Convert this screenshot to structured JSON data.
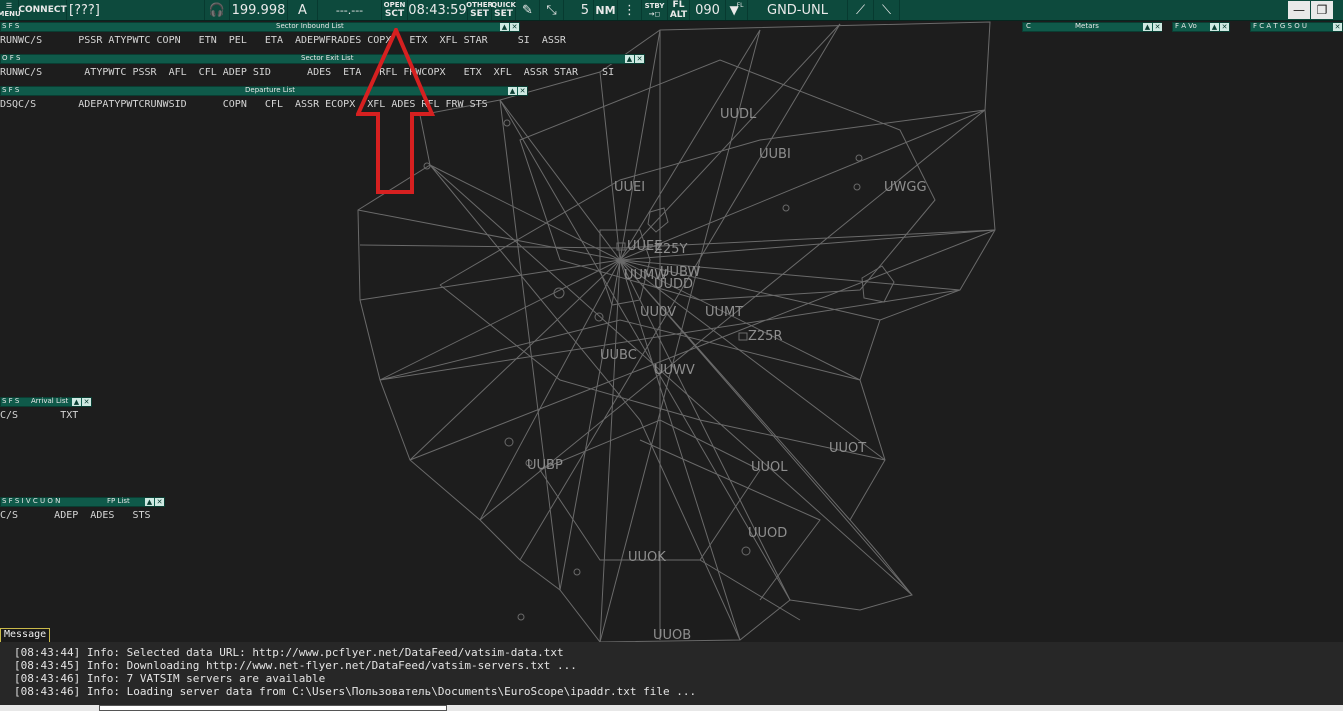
{
  "toolbar": {
    "menu_label": "MENU",
    "connect_label": "CONNECT",
    "callsign": "[???]",
    "frequency": "199.998",
    "atis_letter": "A",
    "atis_value": "---.---",
    "open_label": "OPEN",
    "sct_label": "SCT",
    "clock": "08:43:59",
    "other_label": "OTHER",
    "set_label": "SET",
    "quick_label": "QUICK",
    "set2_label": "SET",
    "range_value": "5",
    "range_unit": "NM",
    "stby_label": "STBY",
    "fl_label": "FL",
    "alt_label": "ALT",
    "fl_value": "090",
    "filter_label": "FL",
    "position": "GND-UNL"
  },
  "lists": {
    "inbound": {
      "title": "Sector Inbound List",
      "flags": "S  F  S",
      "columns": "RUNWC/S      PSSR ATYPWTC COPN   ETN  PEL   ETA  ADEPWFRADES COPX   ETX  XFL STAR     SI  ASSR"
    },
    "exit": {
      "title": "Sector Exit List",
      "flags": "O  F  S",
      "columns": "RUNWC/S       ATYPWTC PSSR  AFL  CFL ADEP SID      ADES  ETA   RFL FRWCOPX   ETX  XFL  ASSR STAR    SI"
    },
    "departure": {
      "title": "Departure List",
      "flags": "S  F  S",
      "columns": "DSQC/S       ADEPATYPWTCRUNWSID      COPN   CFL  ASSR ECOPX  XFL ADES RFL FRW STS"
    },
    "arrival": {
      "title": "Arrival List",
      "flags": "S  F  S",
      "columns": "C/S       TXT"
    },
    "fp": {
      "title": "FP List",
      "flags": "S  F  S  I  V  C  U  O  N",
      "columns": "C/S      ADEP  ADES   STS"
    },
    "metars": {
      "title": "Metars",
      "flag": "C"
    },
    "favo": {
      "title": "F  A  Vo"
    },
    "fcat": {
      "title": "F  C  A  T  G  S  O  U"
    }
  },
  "map_labels": [
    "UUDL",
    "UUBI",
    "UWGG",
    "UUEI",
    "UUEE",
    "Z25Y",
    "UUBW",
    "UUMW",
    "UUDD",
    "UUMT",
    "UU0V",
    "Z25R",
    "UUBC",
    "UUWV",
    "UUOT",
    "UUBP",
    "UUOL",
    "UUOD",
    "UUOK",
    "UUOB"
  ],
  "messages": {
    "button_label": "Message",
    "lines": [
      "[08:43:44] Info: Selected data URL: http://www.pcflyer.net/DataFeed/vatsim-data.txt",
      "[08:43:45] Info: Downloading http://www.net-flyer.net/DataFeed/vatsim-servers.txt ...",
      "[08:43:46] Info: 7 VATSIM servers are available",
      "[08:43:46] Info: Loading server data from C:\\Users\\Пользователь\\Documents\\EuroScope\\ipaddr.txt file ..."
    ]
  },
  "colors": {
    "toolbar": "#0d4a3d",
    "background": "#1d1d1d",
    "map_lines": "#6e6e6e",
    "annotation": "#d62020"
  }
}
